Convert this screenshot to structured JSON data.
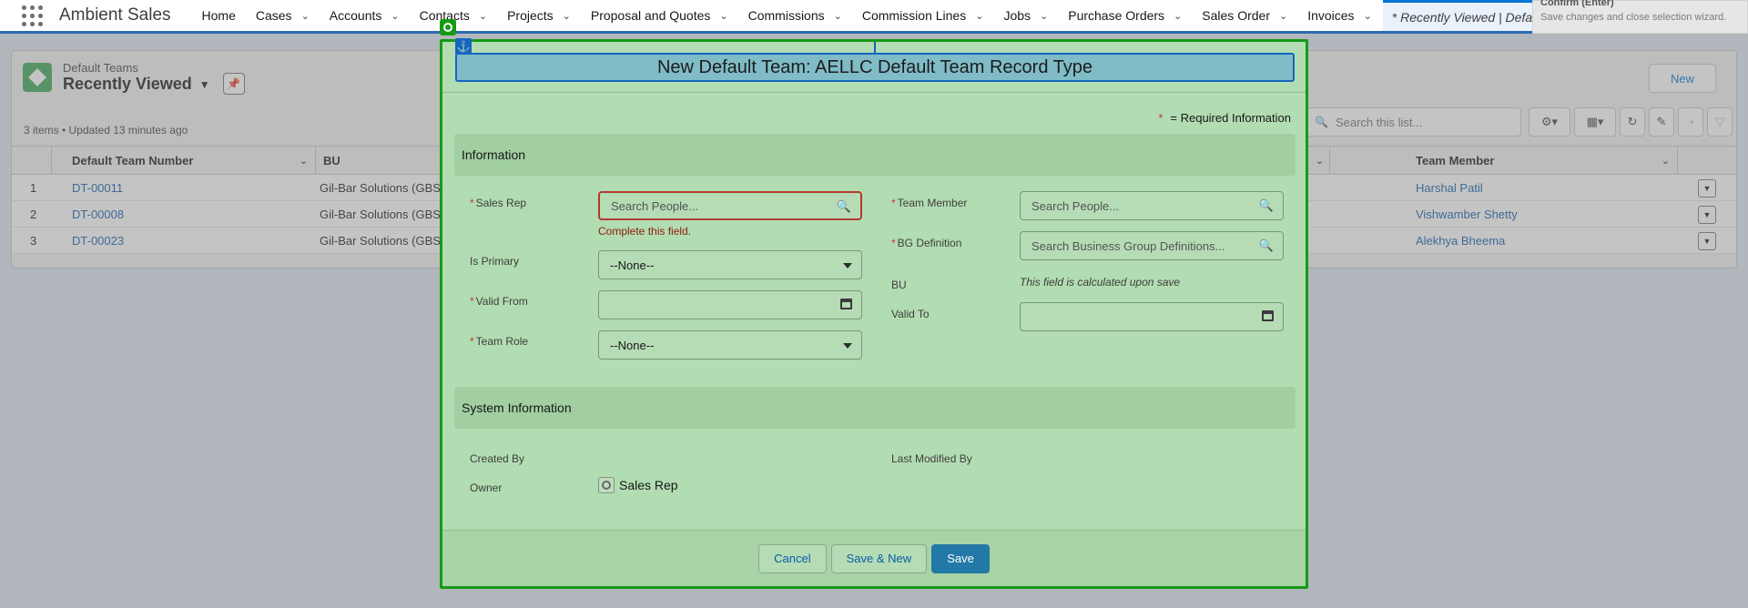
{
  "nav": {
    "app_name": "Ambient Sales",
    "items": [
      {
        "label": "Home",
        "has_menu": false
      },
      {
        "label": "Cases",
        "has_menu": true
      },
      {
        "label": "Accounts",
        "has_menu": true
      },
      {
        "label": "Contacts",
        "has_menu": true
      },
      {
        "label": "Projects",
        "has_menu": true
      },
      {
        "label": "Proposal and Quotes",
        "has_menu": true
      },
      {
        "label": "Commissions",
        "has_menu": true
      },
      {
        "label": "Commission Lines",
        "has_menu": true
      },
      {
        "label": "Jobs",
        "has_menu": true
      },
      {
        "label": "Purchase Orders",
        "has_menu": true
      },
      {
        "label": "Sales Order",
        "has_menu": true
      },
      {
        "label": "Invoices",
        "has_menu": true
      }
    ],
    "active_tab": "* Recently Viewed | Defaul"
  },
  "list_view": {
    "object_name": "Default Teams",
    "view_name": "Recently Viewed",
    "meta": "3 items • Updated 13 minutes ago",
    "new_button": "New",
    "search_placeholder": "Search this list...",
    "columns": [
      "Default Team Number",
      "BU",
      "Team Member"
    ],
    "rows": [
      {
        "num": "1",
        "team_number": "DT-00011",
        "bu": "Gil-Bar Solutions (GBS)",
        "team_member": "Harshal Patil"
      },
      {
        "num": "2",
        "team_number": "DT-00008",
        "bu": "Gil-Bar Solutions (GBS)",
        "team_member": "Vishwamber Shetty"
      },
      {
        "num": "3",
        "team_number": "DT-00023",
        "bu": "Gil-Bar Solutions (GBS)",
        "team_member": "Alekhya Bheema"
      }
    ]
  },
  "modal": {
    "title": "New Default Team: AELLC Default Team Record Type",
    "required_legend": "= Required Information",
    "required_star": "*",
    "section_information": "Information",
    "section_system": "System Information",
    "fields": {
      "sales_rep": {
        "label": "Sales Rep",
        "placeholder": "Search People...",
        "error": "Complete this field."
      },
      "is_primary": {
        "label": "Is Primary",
        "value": "--None--"
      },
      "valid_from": {
        "label": "Valid From",
        "value": ""
      },
      "team_role": {
        "label": "Team Role",
        "value": "--None--"
      },
      "team_member": {
        "label": "Team Member",
        "placeholder": "Search People..."
      },
      "bg_definition": {
        "label": "BG Definition",
        "placeholder": "Search Business Group Definitions..."
      },
      "bu": {
        "label": "BU",
        "note": "This field is calculated upon save"
      },
      "valid_to": {
        "label": "Valid To",
        "value": ""
      },
      "created_by": {
        "label": "Created By"
      },
      "last_modified_by": {
        "label": "Last Modified By"
      },
      "owner": {
        "label": "Owner",
        "value": "Sales Rep"
      }
    },
    "buttons": {
      "cancel": "Cancel",
      "save_new": "Save & New",
      "save": "Save"
    }
  },
  "tooltip": {
    "title": "Confirm (Enter)",
    "body": "Save changes and close selection wizard."
  },
  "colors": {
    "accent": "#0176d3",
    "brand_button": "#2278a6",
    "modal_highlight": "#b2dcb2",
    "modal_border": "#159a15",
    "error": "#b13a2e"
  }
}
